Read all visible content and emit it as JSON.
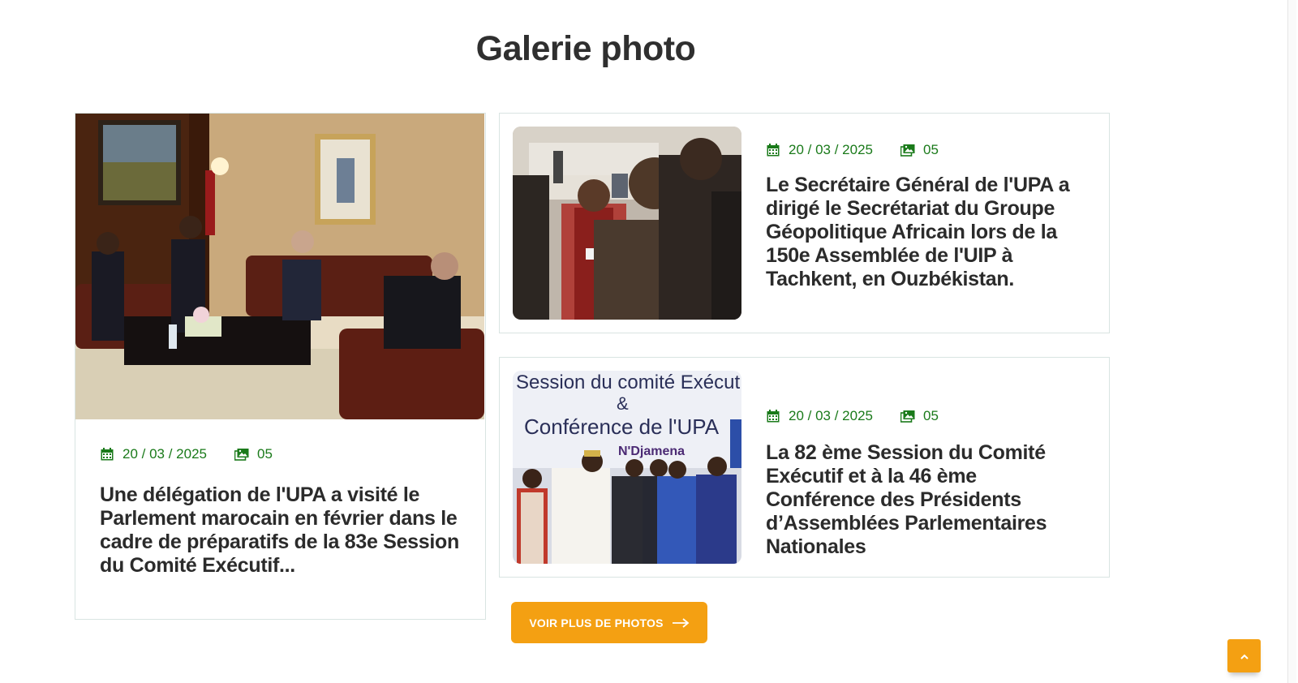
{
  "section": {
    "title": "Galerie photo"
  },
  "articles": [
    {
      "date": "20 / 03 / 2025",
      "photo_count": "05",
      "title": "Une délégation de l'UPA a visité le Parlement marocain en février dans le cadre de préparatifs de la 83e Session du Comité Exécutif..."
    },
    {
      "date": "20 / 03 / 2025",
      "photo_count": "05",
      "title": "Le Secrétaire Général de l'UPA a dirigé le Secrétariat du Groupe Géopolitique Africain lors de la 150e Assemblée de l'UIP à Tachkent, en Ouzbékistan."
    },
    {
      "date": "20 / 03 / 2025",
      "photo_count": "05",
      "title": "La 82 ème Session du Comité Exécutif et à la 46 ème Conférence des Présidents d’Assemblées Parlementaires Nationales",
      "banner_text": [
        "Session du comité Exécut",
        "&",
        "Conférence de l'UPA",
        "N'Djamena"
      ]
    }
  ],
  "more_button": {
    "label": "VOIR PLUS DE PHOTOS",
    "icon": "arrow-right-icon"
  },
  "back_to_top": {
    "icon": "chevron-up-icon"
  },
  "colors": {
    "accent": "#f4a012",
    "meta_green": "#1a7a1a",
    "card_border": "#d9e4e2"
  }
}
